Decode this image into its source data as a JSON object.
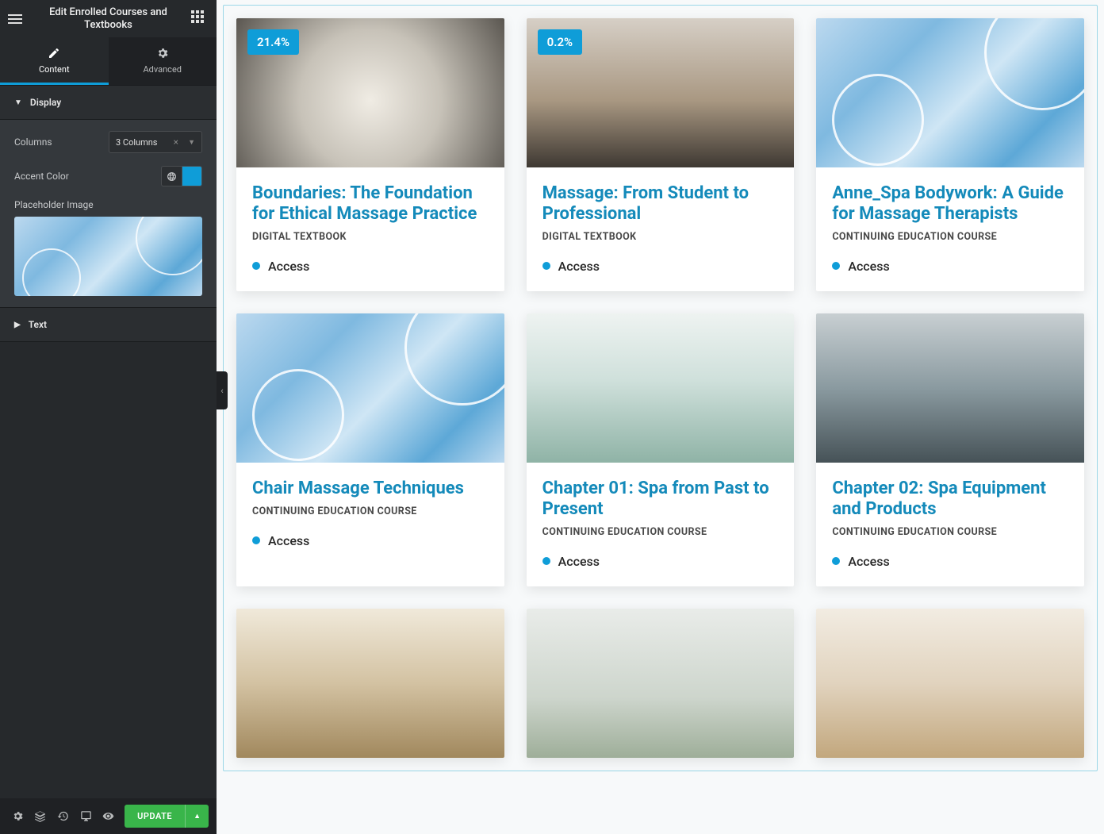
{
  "sidebar": {
    "title": "Edit Enrolled Courses and Textbooks",
    "tabs": {
      "content": "Content",
      "advanced": "Advanced"
    },
    "display_section": {
      "label": "Display",
      "columns_label": "Columns",
      "columns_value": "3 Columns",
      "accent_label": "Accent Color",
      "accent_color": "#0f9dd8",
      "placeholder_label": "Placeholder Image"
    },
    "text_section": {
      "label": "Text"
    },
    "footer": {
      "update": "UPDATE"
    }
  },
  "cards": [
    {
      "title": "Boundaries: The Foundation for Ethical Massage Practice",
      "sub": "DIGITAL TEXTBOOK",
      "status": "Access",
      "badge": "21.4%",
      "img": "photo-a"
    },
    {
      "title": "Massage: From Student to Professional",
      "sub": "DIGITAL TEXTBOOK",
      "status": "Access",
      "badge": "0.2%",
      "img": "photo-b"
    },
    {
      "title": "Anne_Spa Bodywork: A Guide for Massage Therapists",
      "sub": "CONTINUING EDUCATION COURSE",
      "status": "Access",
      "badge": null,
      "img": "watercolor"
    },
    {
      "title": "Chair Massage Techniques",
      "sub": "CONTINUING EDUCATION COURSE",
      "status": "Access",
      "badge": null,
      "img": "watercolor"
    },
    {
      "title": "Chapter 01: Spa from Past to Present",
      "sub": "CONTINUING EDUCATION COURSE",
      "status": "Access",
      "badge": null,
      "img": "photo-c"
    },
    {
      "title": "Chapter 02: Spa Equipment and Products",
      "sub": "CONTINUING EDUCATION COURSE",
      "status": "Access",
      "badge": null,
      "img": "photo-d"
    },
    {
      "title": "",
      "sub": "",
      "status": "",
      "badge": null,
      "img": "photo-e"
    },
    {
      "title": "",
      "sub": "",
      "status": "",
      "badge": null,
      "img": "photo-f"
    },
    {
      "title": "",
      "sub": "",
      "status": "",
      "badge": null,
      "img": "photo-g"
    }
  ]
}
